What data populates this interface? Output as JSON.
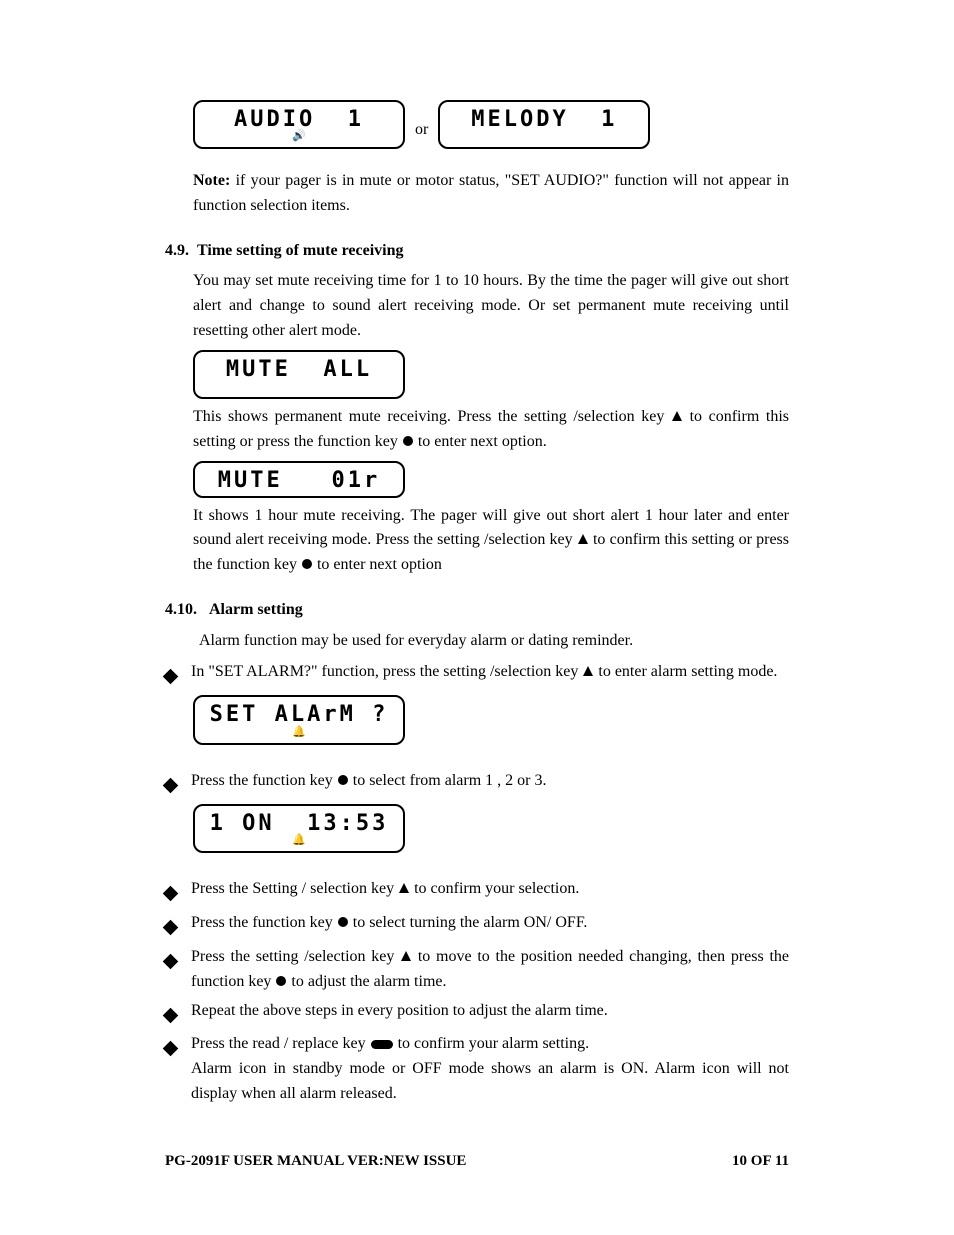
{
  "lcd": {
    "audio": "AUDIO  1",
    "melody": "MELODY  1",
    "mute_all": "MUTE  ALL",
    "mute_01r": "MUTE   01r",
    "set_alarm": "SET ALArM ?",
    "alarm_time": "1 ON  13:53",
    "or": "or",
    "sound_icon": "🔊",
    "bell_icon": "🔔"
  },
  "note": {
    "label": "Note:",
    "text": " if your pager is in mute or motor status, \"SET AUDIO?\" function will not appear in function selection items."
  },
  "s49": {
    "num": "4.9.",
    "title": "Time setting of mute receiving",
    "intro": "You may set mute receiving time for 1 to 10 hours. By the time the pager will give out short alert and change to sound alert receiving mode. Or set permanent mute receiving until resetting other alert mode.",
    "p2a": "This shows permanent mute receiving. Press the setting /selection key ",
    "p2b": " to confirm this setting or press the function key ",
    "p2c": " to enter next option.",
    "p3a": "It shows 1 hour mute receiving. The pager will give out short alert 1 hour later and enter sound alert receiving mode. Press the setting /selection key ",
    "p3b": " to confirm this setting or press the function key ",
    "p3c": " to enter next option"
  },
  "s410": {
    "num": "4.10.",
    "title": "Alarm setting",
    "intro": "Alarm function may be used for everyday alarm or dating reminder.",
    "b1a": "In \"SET ALARM?\" function, press the setting /selection key ",
    "b1b": " to enter alarm setting mode.",
    "b2a": "Press the function key ",
    "b2b": " to select from alarm 1 , 2 or 3.",
    "b3a": "Press the Setting / selection key ",
    "b3b": " to confirm your selection.",
    "b4a": "Press the function key ",
    "b4b": " to select turning the alarm ON/ OFF.",
    "b5a": "Press the setting /selection key ",
    "b5b": " to move to the position needed changing, then press the function key ",
    "b5c": " to adjust the alarm time.",
    "b6": "Repeat the above steps in every position to adjust the alarm time.",
    "b7a": "Press the read / replace key ",
    "b7b": " to confirm your alarm setting.",
    "b7c": "Alarm icon in standby mode or OFF mode shows an alarm is ON. Alarm icon will not display when all alarm released."
  },
  "footer": {
    "left": "PG-2091F    USER MANUAL    VER:NEW ISSUE",
    "right": "10   OF   11"
  }
}
